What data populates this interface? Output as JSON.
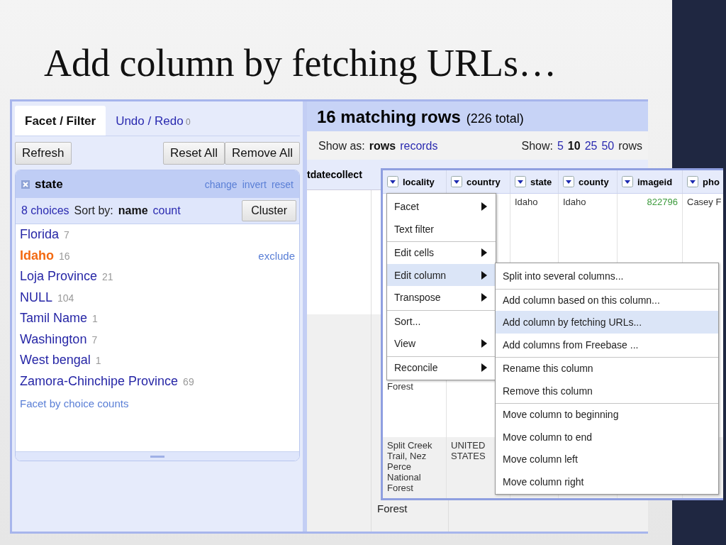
{
  "slide": {
    "title": "Add column by fetching URLs…"
  },
  "left_panel": {
    "tabs": [
      {
        "label": "Facet / Filter",
        "selected": true
      },
      {
        "label": "Undo / Redo",
        "count": "0",
        "selected": false
      }
    ],
    "refresh_button": "Refresh",
    "button_group": [
      "Reset All",
      "Remove All"
    ],
    "facet": {
      "title": "state",
      "actions": [
        "change",
        "invert",
        "reset"
      ],
      "choices_count": "8 choices",
      "sort_label": "Sort by:",
      "sort_options": [
        {
          "label": "name",
          "selected": true
        },
        {
          "label": "count",
          "selected": false
        }
      ],
      "cluster_button": "Cluster",
      "choices": [
        {
          "name": "Florida",
          "count": "7",
          "selected": false
        },
        {
          "name": "Idaho",
          "count": "16",
          "selected": true,
          "action": "exclude"
        },
        {
          "name": "Loja Province",
          "count": "21",
          "selected": false
        },
        {
          "name": "NULL",
          "count": "104",
          "selected": false
        },
        {
          "name": "Tamil Name",
          "count": "1",
          "selected": false
        },
        {
          "name": "Washington",
          "count": "7",
          "selected": false
        },
        {
          "name": "West bengal",
          "count": "1",
          "selected": false
        },
        {
          "name": "Zamora-Chinchipe Province",
          "count": "69",
          "selected": false
        }
      ],
      "footer_link": "Facet by choice counts"
    }
  },
  "data_panel": {
    "matching": "16 matching rows",
    "total": "(226 total)",
    "show_as_label": "Show as:",
    "show_as_options": [
      {
        "label": "rows",
        "selected": true
      },
      {
        "label": "records",
        "selected": false
      }
    ],
    "show_label": "Show:",
    "show_options": [
      {
        "label": "5",
        "selected": false
      },
      {
        "label": "10",
        "selected": true
      },
      {
        "label": "25",
        "selected": false
      },
      {
        "label": "50",
        "selected": false
      }
    ],
    "show_suffix": "rows",
    "back_header": "tdatecollect",
    "back_cell": "Forest"
  },
  "overlay": {
    "columns": [
      "locality",
      "country",
      "state",
      "county",
      "imageid",
      "pho"
    ],
    "rows": [
      {
        "cells": [
          "Forest",
          null,
          "Idaho",
          "Idaho",
          "822796",
          "Casey F"
        ]
      },
      {
        "cells": [
          "Split Creek Trail, Nez Perce National Forest",
          "UNITED STATES",
          null,
          null,
          null,
          null
        ]
      }
    ],
    "menu": [
      {
        "label": "Facet",
        "submenu": true,
        "separator_before": false,
        "selected": false
      },
      {
        "label": "Text filter",
        "submenu": false,
        "separator_before": false,
        "selected": false
      },
      {
        "label": "Edit cells",
        "submenu": true,
        "separator_before": true,
        "selected": false
      },
      {
        "label": "Edit column",
        "submenu": true,
        "separator_before": false,
        "selected": true
      },
      {
        "label": "Transpose",
        "submenu": true,
        "separator_before": false,
        "selected": false
      },
      {
        "label": "Sort...",
        "submenu": false,
        "separator_before": true,
        "selected": false
      },
      {
        "label": "View",
        "submenu": true,
        "separator_before": false,
        "selected": false
      },
      {
        "label": "Reconcile",
        "submenu": true,
        "separator_before": true,
        "selected": false
      }
    ],
    "submenu": [
      {
        "label": "Split into several columns...",
        "separator_before": false,
        "selected": false
      },
      {
        "label": "Add column based on this column...",
        "separator_before": true,
        "selected": false
      },
      {
        "label": "Add column by fetching URLs...",
        "separator_before": false,
        "selected": true
      },
      {
        "label": "Add columns from Freebase ...",
        "separator_before": false,
        "selected": false
      },
      {
        "label": "Rename this column",
        "separator_before": true,
        "selected": false
      },
      {
        "label": "Remove this column",
        "separator_before": false,
        "selected": false
      },
      {
        "label": "Move column to beginning",
        "separator_before": true,
        "selected": false
      },
      {
        "label": "Move column to end",
        "separator_before": false,
        "selected": false
      },
      {
        "label": "Move column left",
        "separator_before": false,
        "selected": false
      },
      {
        "label": "Move column right",
        "separator_before": false,
        "selected": false
      }
    ]
  }
}
